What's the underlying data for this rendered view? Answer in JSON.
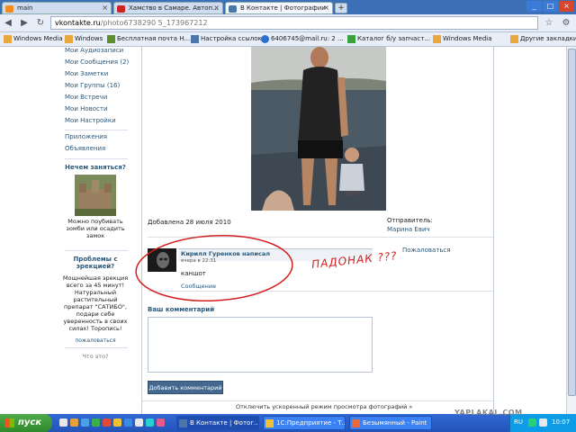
{
  "tabs": [
    {
      "label": "main"
    },
    {
      "label": "Хамство в Самаре. Автоп..."
    },
    {
      "label": "В Контакте | Фотографии"
    }
  ],
  "toolbar": {
    "new_tab": "+",
    "back": "◀",
    "forward": "▶",
    "reload": "↻",
    "star": "☆",
    "wrench": "🔧"
  },
  "address": {
    "host": "vkontakte.ru",
    "path": "/photo6738290 5_173967212"
  },
  "bookmarks": [
    {
      "label": "Windows Media"
    },
    {
      "label": "Windows"
    },
    {
      "label": "Бесплатная почта Н..."
    },
    {
      "label": "Настройка ссылок"
    },
    {
      "label": "6406745@mail.ru: 2 ..."
    },
    {
      "label": "Каталог б/у запчаст..."
    },
    {
      "label": "Windows Media"
    },
    {
      "label": "Другие закладки"
    }
  ],
  "leftnav": {
    "links": [
      {
        "label": "Мои Аудиозаписи"
      },
      {
        "label": "Мои Сообщения (2)"
      },
      {
        "label": "Мои Заметки"
      },
      {
        "label": "Мои Группы (16)"
      },
      {
        "label": "Мои Встречи"
      },
      {
        "label": "Мои Новости"
      },
      {
        "label": "Мои Настройки"
      }
    ],
    "links2": [
      {
        "label": "Приложения"
      },
      {
        "label": "Объявления"
      }
    ],
    "ad1": {
      "title": "Нечем заняться?",
      "text": "Можно поубивать зомби или осадить замок"
    },
    "ad2": {
      "title": "Проблемы с эрекцией?",
      "text": "Мощнейшая эрекция всего за 45 минут! Натуральный растительный препарат \"САТИБО\", подари себе уверенность в своих силах! Торопись!",
      "complain": "пожаловаться"
    },
    "what": "Что это?"
  },
  "photo_meta": {
    "added": "Добавлена 28 июля 2010",
    "sender_label": "Отправитель:",
    "sender_name": "Марина Евич",
    "complain": "Пожаловаться"
  },
  "comment": {
    "author": "Кирилл Гуренков написал",
    "time": "вчера в 22:31",
    "text": "каншот",
    "reply": "Сообщение"
  },
  "annotation": {
    "text": "ПАДОНАК ???"
  },
  "form": {
    "label": "Ваш комментарий",
    "submit": "Добавить комментарий"
  },
  "footer": {
    "fast_view": "Отключить ускоренный режим просмотра фотографий »"
  },
  "taskbar": {
    "start": "пуск",
    "items": [
      {
        "label": "В Контакте | Фотог..."
      },
      {
        "label": "1С:Предприятие - Т..."
      },
      {
        "label": "Безымянный - Paint"
      }
    ],
    "tray_text": "RU",
    "clock": "10:07"
  },
  "watermark": "YAPLAKAL.COM",
  "colors": {
    "vk_blue": "#2b587a",
    "xp_taskbar": "#2354b8",
    "annotation_red": "#d22020"
  }
}
